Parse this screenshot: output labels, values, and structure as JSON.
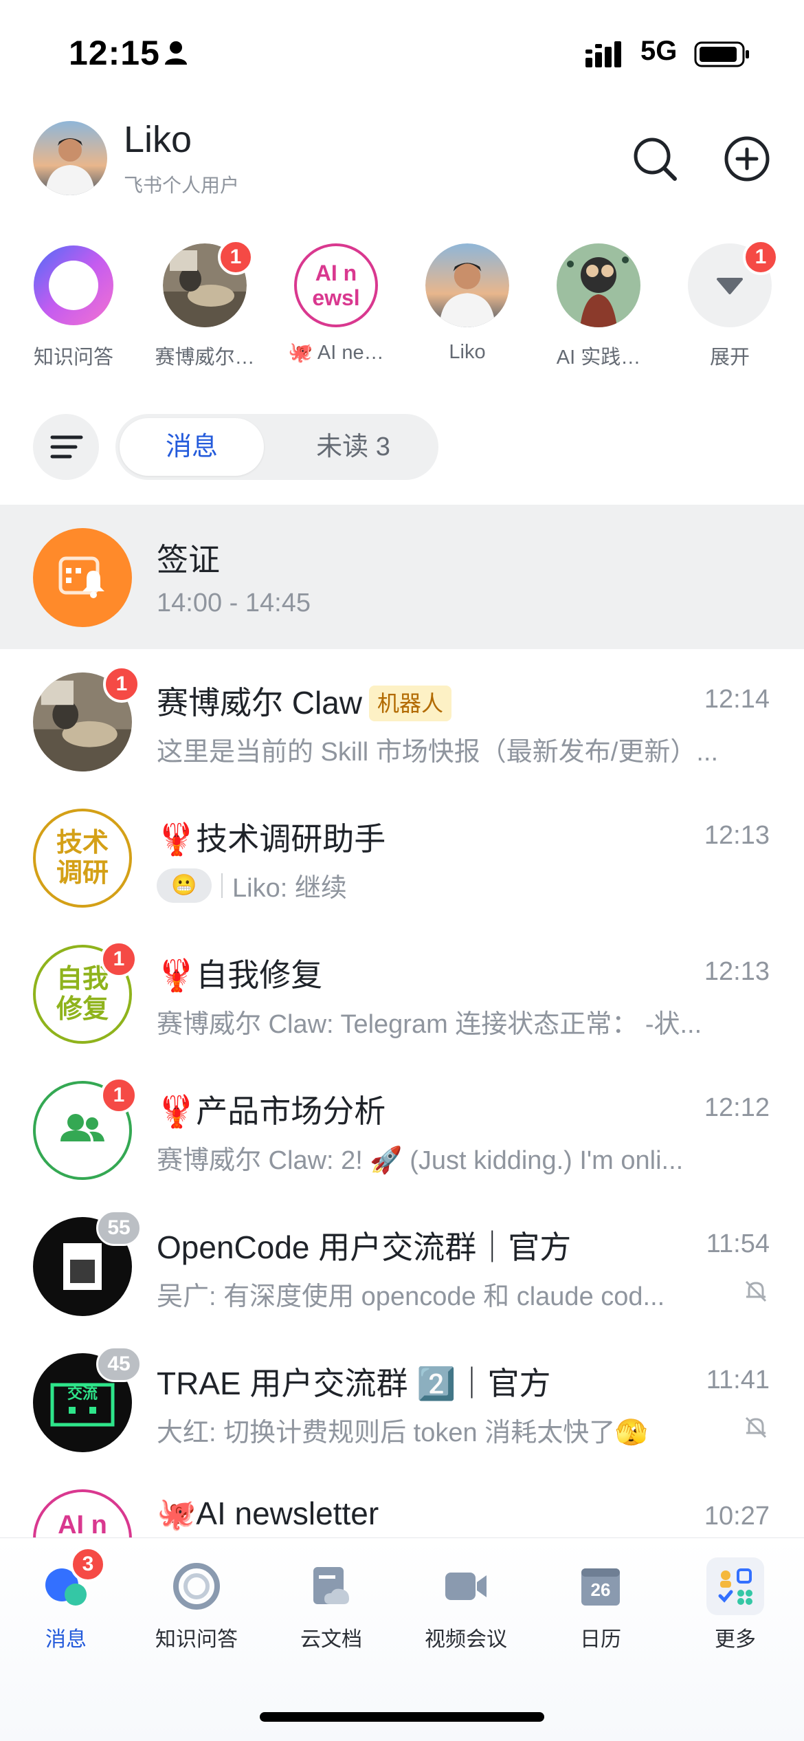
{
  "status_bar": {
    "time": "12:15",
    "network": "5G"
  },
  "profile": {
    "name": "Liko",
    "subtitle": "飞书个人用户"
  },
  "quick_access": [
    {
      "label": "知识问答",
      "icon": "knowledge-ring-icon",
      "badge": null
    },
    {
      "label": "赛博威尔…",
      "icon": "dog-photo-avatar",
      "badge": "1"
    },
    {
      "label": "🐙 AI ne…",
      "icon": "ai-newsletter-text-avatar",
      "avatar_text": "AI n ewsl",
      "badge": null
    },
    {
      "label": "Liko",
      "icon": "person-photo-avatar",
      "badge": null
    },
    {
      "label": "AI 实践…",
      "icon": "film-art-avatar",
      "badge": null
    },
    {
      "label": "展开",
      "icon": "expand-down-icon",
      "badge": "1"
    }
  ],
  "segment": {
    "active": "消息",
    "other": "未读 3"
  },
  "chats": [
    {
      "title": "签证",
      "preview": "14:00 - 14:45",
      "time": "",
      "avatar": "calendar-bell-icon",
      "pinned": true
    },
    {
      "title": "赛博威尔 Claw",
      "tag": "机器人",
      "preview": "这里是当前的 Skill 市场快报（最新发布/更新）...",
      "time": "12:14",
      "avatar": "dog-photo-avatar",
      "badge": "1"
    },
    {
      "title": "🦞技术调研助手",
      "preview": "Liko: 继续",
      "time": "12:13",
      "avatar_text": "技术\n调研",
      "badge": null
    },
    {
      "title": "🦞自我修复",
      "preview": "赛博威尔 Claw: Telegram 连接状态正常： -状...",
      "time": "12:13",
      "avatar_text": "自我\n修复",
      "badge": "1"
    },
    {
      "title": "🦞产品市场分析",
      "preview": "赛博威尔 Claw: 2! 🚀 (Just kidding.) I'm onli...",
      "time": "12:12",
      "avatar": "group-people-icon",
      "badge": "1"
    },
    {
      "title": "OpenCode 用户交流群｜官方",
      "preview": "吴广: 有深度使用 opencode 和 claude cod...",
      "time": "11:54",
      "avatar": "opencode-logo",
      "badge": "55",
      "muted": true
    },
    {
      "title": "TRAE 用户交流群 2️⃣｜官方",
      "preview": "大红: 切换计费规则后 token 消耗太快了🫣",
      "time": "11:41",
      "avatar": "trae-logo",
      "badge": "45",
      "muted": true
    },
    {
      "title": "🐙AI newsletter",
      "preview": "",
      "time": "10:27",
      "avatar_text": "AI n",
      "badge": null
    }
  ],
  "tabbar": [
    {
      "label": "消息",
      "icon": "chat-bubbles-icon",
      "badge": "3",
      "active": true
    },
    {
      "label": "知识问答",
      "icon": "knowledge-swirl-icon"
    },
    {
      "label": "云文档",
      "icon": "cloud-doc-icon"
    },
    {
      "label": "视频会议",
      "icon": "video-camera-icon"
    },
    {
      "label": "日历",
      "icon": "calendar-icon",
      "calendar_day": "26"
    },
    {
      "label": "更多",
      "icon": "apps-grid-icon"
    }
  ],
  "colors": {
    "accent": "#245bdb",
    "badge_red": "#f54a45",
    "muted_text": "#8f959e",
    "bot_tag_bg": "#fdf1c5"
  }
}
